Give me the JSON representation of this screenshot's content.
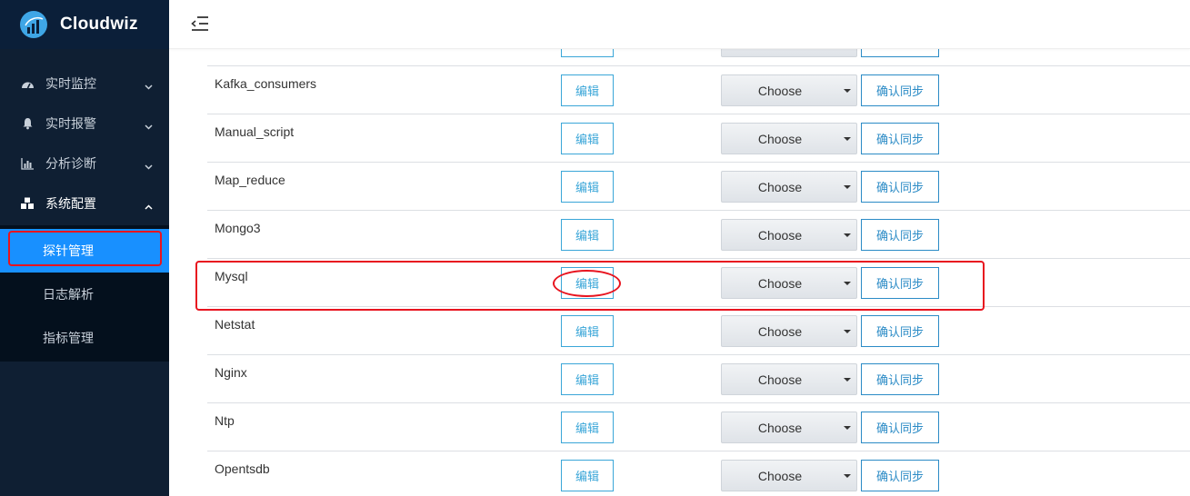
{
  "app": {
    "brand_name": "Cloudwiz",
    "logo_icon": "cloudwiz-logo-icon",
    "accent_color": "#1890ff",
    "annotation_color": "#e8141f"
  },
  "header": {
    "toggle_icon": "menu-collapse-icon"
  },
  "sidebar": {
    "items": [
      {
        "label": "实时监控",
        "icon": "dashboard-icon",
        "expanded": false
      },
      {
        "label": "实时报警",
        "icon": "bell-icon",
        "expanded": false
      },
      {
        "label": "分析诊断",
        "icon": "bar-chart-icon",
        "expanded": false
      },
      {
        "label": "系统配置",
        "icon": "cubes-icon",
        "expanded": true
      }
    ],
    "sub_items": [
      {
        "label": "探针管理",
        "active": true
      },
      {
        "label": "日志解析",
        "active": false
      },
      {
        "label": "指标管理",
        "active": false
      }
    ]
  },
  "table": {
    "edit_label": "编辑",
    "select_value": "Choose",
    "sync_label": "确认同步",
    "rows": [
      {
        "name": ""
      },
      {
        "name": "Kafka_consumers"
      },
      {
        "name": "Manual_script"
      },
      {
        "name": "Map_reduce"
      },
      {
        "name": "Mongo3"
      },
      {
        "name": "Mysql"
      },
      {
        "name": "Netstat"
      },
      {
        "name": "Nginx"
      },
      {
        "name": "Ntp"
      },
      {
        "name": "Opentsdb"
      }
    ]
  }
}
